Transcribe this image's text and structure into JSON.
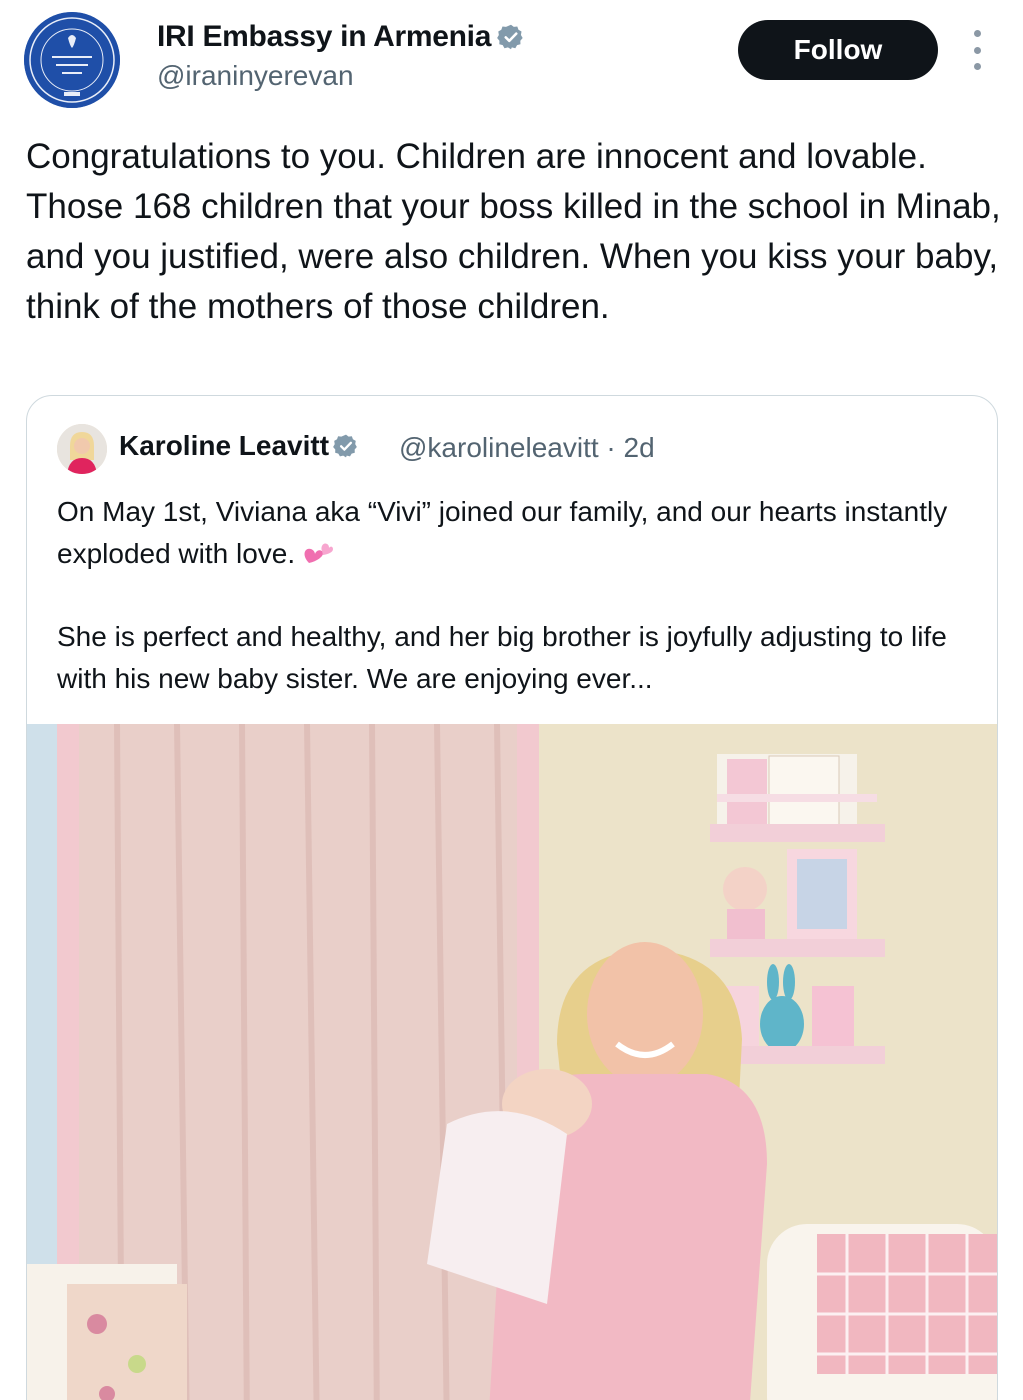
{
  "header": {
    "display_name": "IRI Embassy in Armenia",
    "handle": "@iraninyerevan",
    "follow_label": "Follow",
    "avatar_icon": "embassy-seal-icon",
    "verified_icon": "verified-badge-icon",
    "more_icon": "more-vertical-icon"
  },
  "tweet": {
    "text": "Congratulations to you. Children are innocent and lovable. Those 168 children that your boss killed in the school in Minab, and you justified, were also children. When you kiss your baby, think of the mothers of those children."
  },
  "quoted_tweet": {
    "display_name": "Karoline Leavitt",
    "handle": "@karolineleavitt",
    "separator": "·",
    "time": "2d",
    "paragraph_1": "On May 1st, Viviana aka “Vivi” joined our family, and our hearts instantly exploded with love.",
    "paragraph_1_emoji": "two-hearts-emoji",
    "paragraph_2": "She is perfect and healthy, and her big brother is joyfully adjusting to life with his new baby sister. We are enjoying ever...",
    "photo": "nursery-photo"
  },
  "colors": {
    "text": "#0f1419",
    "secondary": "#536471",
    "follow_bg": "#0f1419",
    "verified": "#829aab",
    "border": "#cfd9de",
    "seal": "#1f4fa8"
  }
}
